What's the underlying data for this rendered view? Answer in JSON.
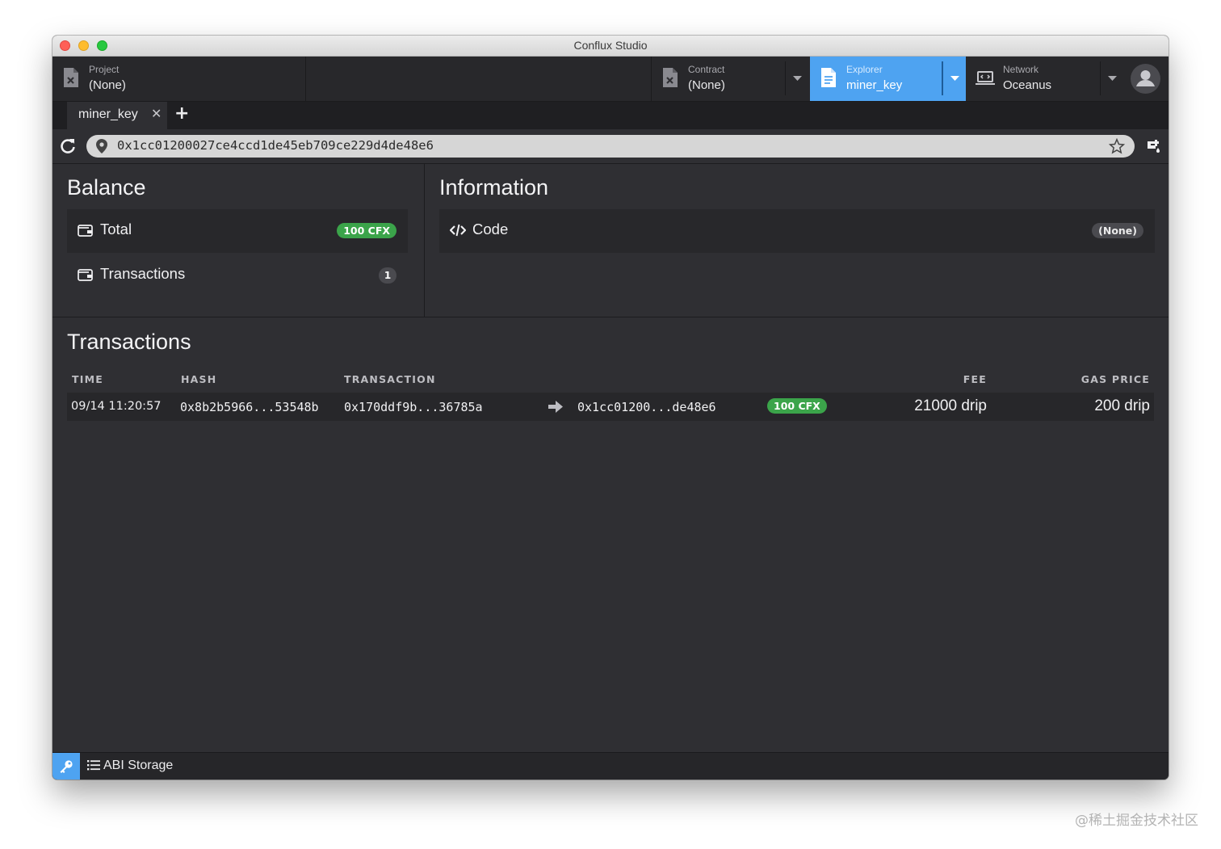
{
  "window": {
    "title": "Conflux Studio"
  },
  "topnav": {
    "project": {
      "label": "Project",
      "value": "(None)"
    },
    "contract": {
      "label": "Contract",
      "value": "(None)"
    },
    "explorer": {
      "label": "Explorer",
      "value": "miner_key"
    },
    "network": {
      "label": "Network",
      "value": "Oceanus"
    },
    "accent_color": "#4ea3f1"
  },
  "tabs": [
    {
      "label": "miner_key"
    }
  ],
  "address_bar": {
    "value": "0x1cc01200027ce4ccd1de45eb709ce229d4de48e6"
  },
  "balance": {
    "title": "Balance",
    "total": {
      "label": "Total",
      "badge": "100 CFX"
    },
    "transactions": {
      "label": "Transactions",
      "count": "1"
    }
  },
  "information": {
    "title": "Information",
    "code": {
      "label": "Code",
      "badge": "(None)"
    }
  },
  "transactions": {
    "title": "Transactions",
    "headers": {
      "time": "TIME",
      "hash": "HASH",
      "transaction": "TRANSACTION",
      "fee": "FEE",
      "gas_price": "GAS PRICE"
    },
    "rows": [
      {
        "time": "09/14 11:20:57",
        "hash": "0x8b2b5966...53548b",
        "from": "0x170ddf9b...36785a",
        "to": "0x1cc01200...de48e6",
        "value": "100 CFX",
        "fee": "21000 drip",
        "gas_price": "200 drip"
      }
    ]
  },
  "statusbar": {
    "abi_label": "ABI Storage"
  },
  "watermark": "@稀土掘金技术社区"
}
